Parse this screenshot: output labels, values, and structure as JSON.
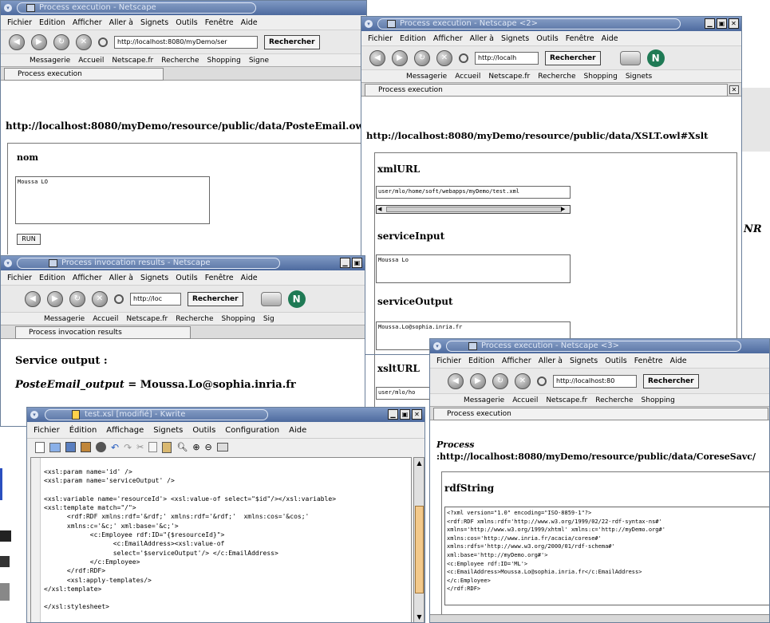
{
  "win1": {
    "title": "Process execution - Netscape",
    "menu": [
      "Fichier",
      "Edition",
      "Afficher",
      "Aller à",
      "Signets",
      "Outils",
      "Fenêtre",
      "Aide"
    ],
    "url": "http://localhost:8080/myDemo/ser",
    "search_label": "Rechercher",
    "bookmarks": [
      "Messagerie",
      "Accueil",
      "Netscape.fr",
      "Recherche",
      "Shopping",
      "Signe"
    ],
    "tab_label": "Process execution",
    "heading": "http://localhost:8080/myDemo/resource/public/data/PosteEmail.owl#",
    "field_label": "nom",
    "field_value": "Moussa LO",
    "run_label": "RUN"
  },
  "win2": {
    "title": "Process execution - Netscape <2>",
    "menu": [
      "Fichier",
      "Edition",
      "Afficher",
      "Aller à",
      "Signets",
      "Outils",
      "Fenêtre",
      "Aide"
    ],
    "url": "http://localh",
    "search_label": "Rechercher",
    "bookmarks": [
      "Messagerie",
      "Accueil",
      "Netscape.fr",
      "Recherche",
      "Shopping",
      "Signets"
    ],
    "tab_label": "Process execution",
    "heading": "http://localhost:8080/myDemo/resource/public/data/XSLT.owl#Xslt",
    "xmlurl_label": "xmlURL",
    "xmlurl_value": "user/mlo/home/soft/webapps/myDemo/test.xml",
    "serviceinput_label": "serviceInput",
    "serviceinput_value": "Moussa Lo",
    "serviceoutput_label": "serviceOutput",
    "serviceoutput_value": "Moussa.Lo@sophia.inria.fr",
    "xslturl_label": "xsltURL",
    "xslturl_value": "user/mlo/ho"
  },
  "win3": {
    "title": "Process invocation results - Netscape",
    "menu": [
      "Fichier",
      "Edition",
      "Afficher",
      "Aller à",
      "Signets",
      "Outils",
      "Fenêtre",
      "Aide"
    ],
    "url": "http://loc",
    "search_label": "Rechercher",
    "bookmarks": [
      "Messagerie",
      "Accueil",
      "Netscape.fr",
      "Recherche",
      "Shopping",
      "Sig"
    ],
    "tab_label": "Process invocation results",
    "heading": "Service output :",
    "output_key": "PosteEmail_output",
    "output_value": " = Moussa.Lo@sophia.inria.fr"
  },
  "win4": {
    "title": "test.xsl [modifié] - Kwrite",
    "menu": [
      "Fichier",
      "Édition",
      "Affichage",
      "Signets",
      "Outils",
      "Configuration",
      "Aide"
    ],
    "code_lines": [
      "<xsl:param name='id' />",
      "<xsl:param name='serviceOutput' />",
      "",
      "<xsl:variable name='resourceId'> <xsl:value-of select=\"$id\"/></xsl:variable>",
      "<xsl:template match=\"/\">",
      "      <rdf:RDF xmlns:rdf='&rdf;' xmlns:rdf='&rdf;'  xmlns:cos='&cos;'",
      "      xmlns:c='&c;' xml:base='&c;'>",
      "            <c:Employee rdf:ID=\"{$resourceId}\">",
      "                  <c:EmailAddress><xsl:value-of",
      "                  select='$serviceOutput'/> </c:EmailAddress>",
      "            </c:Employee>",
      "      </rdf:RDF>",
      "      <xsl:apply-templates/>",
      "</xsl:template>",
      "",
      "</xsl:stylesheet>"
    ]
  },
  "win5": {
    "title": "Process execution - Netscape <3>",
    "menu": [
      "Fichier",
      "Edition",
      "Afficher",
      "Aller à",
      "Signets",
      "Outils",
      "Fenêtre",
      "Aide"
    ],
    "url": "http://localhost:80",
    "search_label": "Rechercher",
    "bookmarks": [
      "Messagerie",
      "Accueil",
      "Netscape.fr",
      "Recherche",
      "Shopping"
    ],
    "tab_label": "Process execution",
    "heading1": "Process",
    "heading2": ":http://localhost:8080/myDemo/resource/public/data/CoreseSavc/",
    "field_label": "rdfString",
    "rdf_text": "<?xml version=\"1.0\" encoding=\"ISO-8859-1\"?>\n<rdf:RDF xmlns:rdf='http://www.w3.org/1999/02/22-rdf-syntax-ns#'\nxmlns='http://www.w3.org/1999/xhtml' xmlns:c='http://myDemo.org#'\nxmlns:cos='http://www.inria.fr/acacia/corese#'\nxmlns:rdfs='http://www.w3.org/2000/01/rdf-schema#'\nxml:base='http://myDemo.org#'>\n<c:Employee rdf:ID='ML'>\n<c:EmailAddress>Moussa.Lo@sophia.inria.fr</c:EmailAddress>\n</c:Employee>\n</rdf:RDF>"
  },
  "bg": {
    "right_logo": "NR"
  }
}
